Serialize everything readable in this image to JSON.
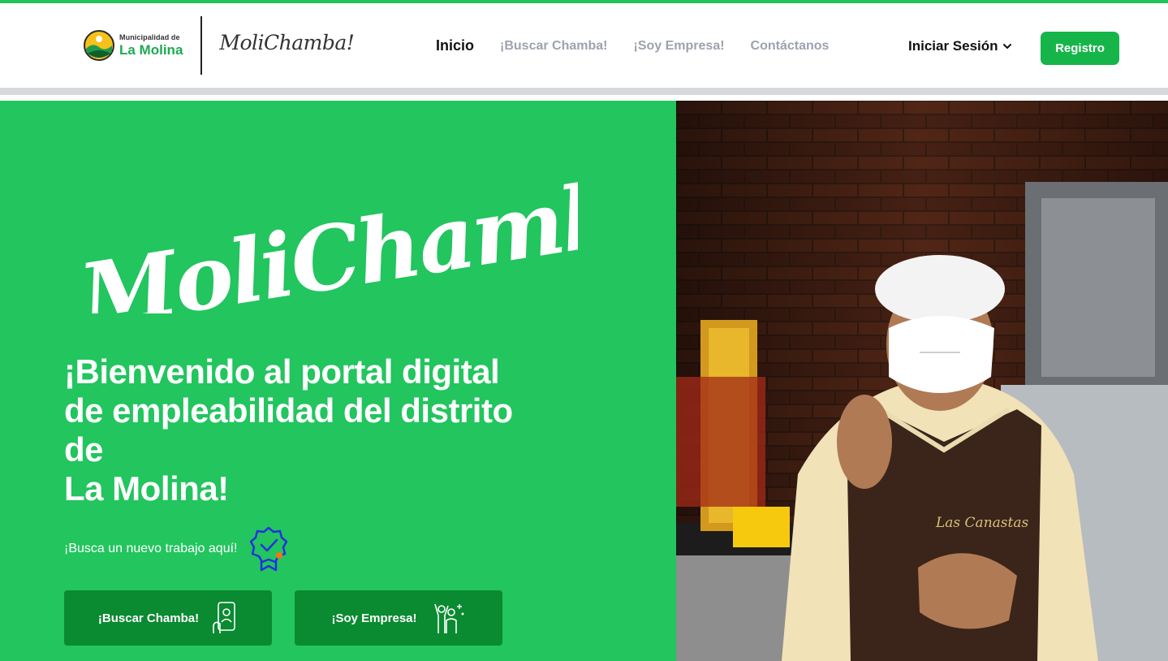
{
  "header": {
    "muni_small": "Municipalidad de",
    "muni_name": "La Molina",
    "brand_script": "MoliChamba!",
    "nav": [
      {
        "label": "Inicio",
        "active": true
      },
      {
        "label": "¡Buscar Chamba!",
        "active": false
      },
      {
        "label": "¡Soy Empresa!",
        "active": false
      },
      {
        "label": "Contáctanos",
        "active": false
      }
    ],
    "login_label": "Iniciar Sesión",
    "register_label": "Registro"
  },
  "hero": {
    "script_title": "MoliChamba!",
    "title_line1": "¡Bienvenido al portal digital",
    "title_line2": "de empleabilidad del distrito",
    "title_line3": "de",
    "title_line4": "La Molina!",
    "subtitle": "¡Busca un nuevo trabajo aquí!",
    "btn_chamba": "¡Buscar Chamba!",
    "btn_empresa": "¡Soy Empresa!",
    "photo": {
      "apron_text": "Las Canastas"
    }
  },
  "colors": {
    "brand_green": "#22c55e",
    "button_green": "#16b54a",
    "dark_button_green": "#0a8a31",
    "badge_blue": "#2431e0",
    "badge_orange": "#f97316"
  }
}
